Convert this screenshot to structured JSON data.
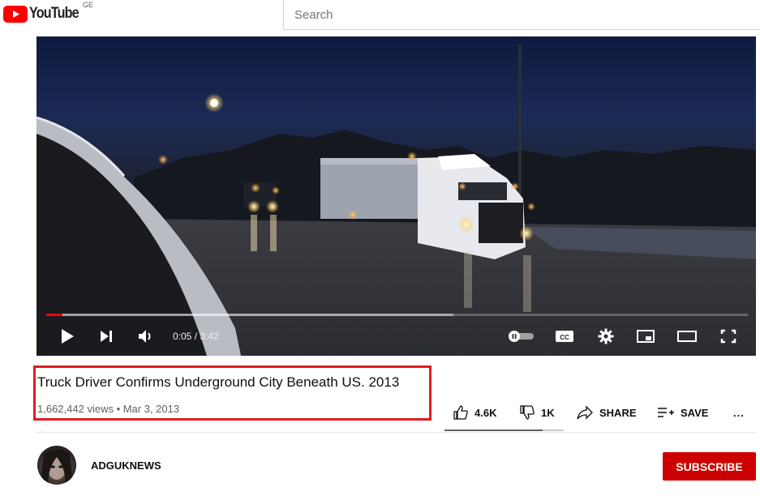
{
  "header": {
    "logo_text": "YouTube",
    "region_code": "GE",
    "search_placeholder": "Search"
  },
  "player": {
    "current_time": "0:05",
    "duration": "3:42",
    "time_display": "0:05 / 3:42",
    "progress_fraction": 0.023,
    "buffered_fraction": 0.58
  },
  "video": {
    "title": "Truck Driver Confirms Underground City Beneath US. 2013",
    "meta": "1,662,442 views • Mar 3, 2013"
  },
  "actions": {
    "like_label": "4.6K",
    "dislike_label": "1K",
    "share_label": "SHARE",
    "save_label": "SAVE",
    "more_label": "...",
    "like_ratio": 0.82
  },
  "channel": {
    "name": "ADGUKNEWS",
    "subscribe_label": "SUBSCRIBE"
  },
  "colors": {
    "brand_red": "#ff0000",
    "subscribe_red": "#cc0000",
    "highlight_box": "#e01b24"
  }
}
